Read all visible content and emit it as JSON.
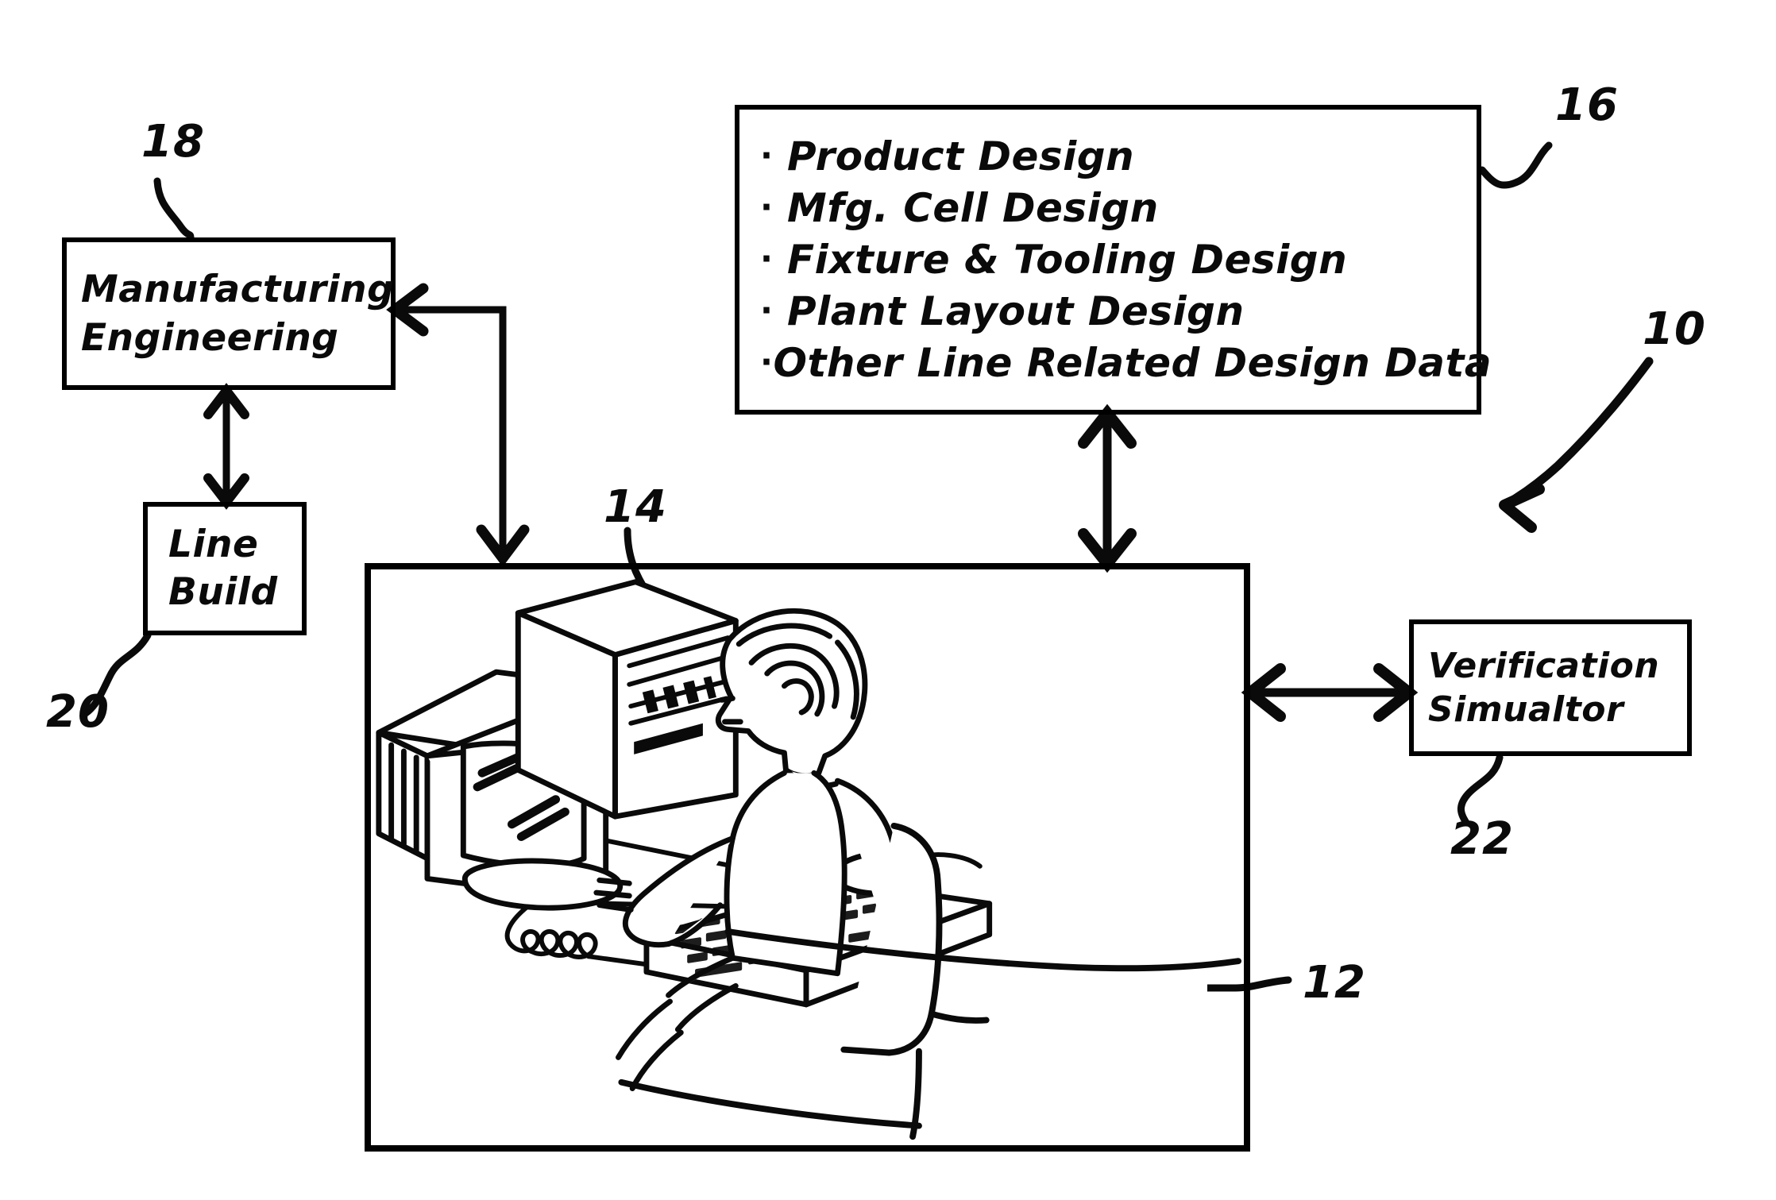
{
  "figure": {
    "title": "Manufacturing line design and verification system block diagram",
    "style": "patent-line-drawing",
    "ink_color": "#0a0a0a",
    "background_color": "#ffffff"
  },
  "boxes": {
    "manufacturing_engineering": {
      "ref": "18",
      "lines": [
        "Manufacturing",
        "Engineering"
      ]
    },
    "line_build": {
      "ref": "20",
      "lines": [
        "Line",
        "Build"
      ]
    },
    "design_list": {
      "ref": "16",
      "bullet": "·",
      "items": [
        "Product Design",
        "Mfg. Cell Design",
        "Fixture & Tooling Design",
        "Plant Layout Design",
        "Other Line Related Design Data"
      ]
    },
    "verification_simulator": {
      "ref": "22",
      "lines": [
        "Verification",
        "Simualtor"
      ]
    },
    "workstation_panel": {
      "ref": "12",
      "computer_ref": "14",
      "contents": "Engineer seated at CAD workstation with CRT monitor, tower computer, keyboard and mouse"
    }
  },
  "reference_numerals": {
    "system": "10",
    "workstation": "12",
    "computer": "14",
    "design_data": "16",
    "manufacturing_engineering": "18",
    "line_build": "20",
    "verification_simulator": "22"
  },
  "connectors": [
    {
      "name": "panel-to-manufacturing-engineering",
      "from": "workstation_panel",
      "to": "manufacturing_engineering",
      "arrows": "both",
      "shape": "elbow"
    },
    {
      "name": "manufacturing-engineering-to-line-build",
      "from": "manufacturing_engineering",
      "to": "line_build",
      "arrows": "both",
      "shape": "vertical"
    },
    {
      "name": "design-list-to-panel",
      "from": "design_list",
      "to": "workstation_panel",
      "arrows": "both",
      "shape": "vertical"
    },
    {
      "name": "panel-to-verification-simulator",
      "from": "workstation_panel",
      "to": "verification_simulator",
      "arrows": "both",
      "shape": "horizontal"
    }
  ]
}
